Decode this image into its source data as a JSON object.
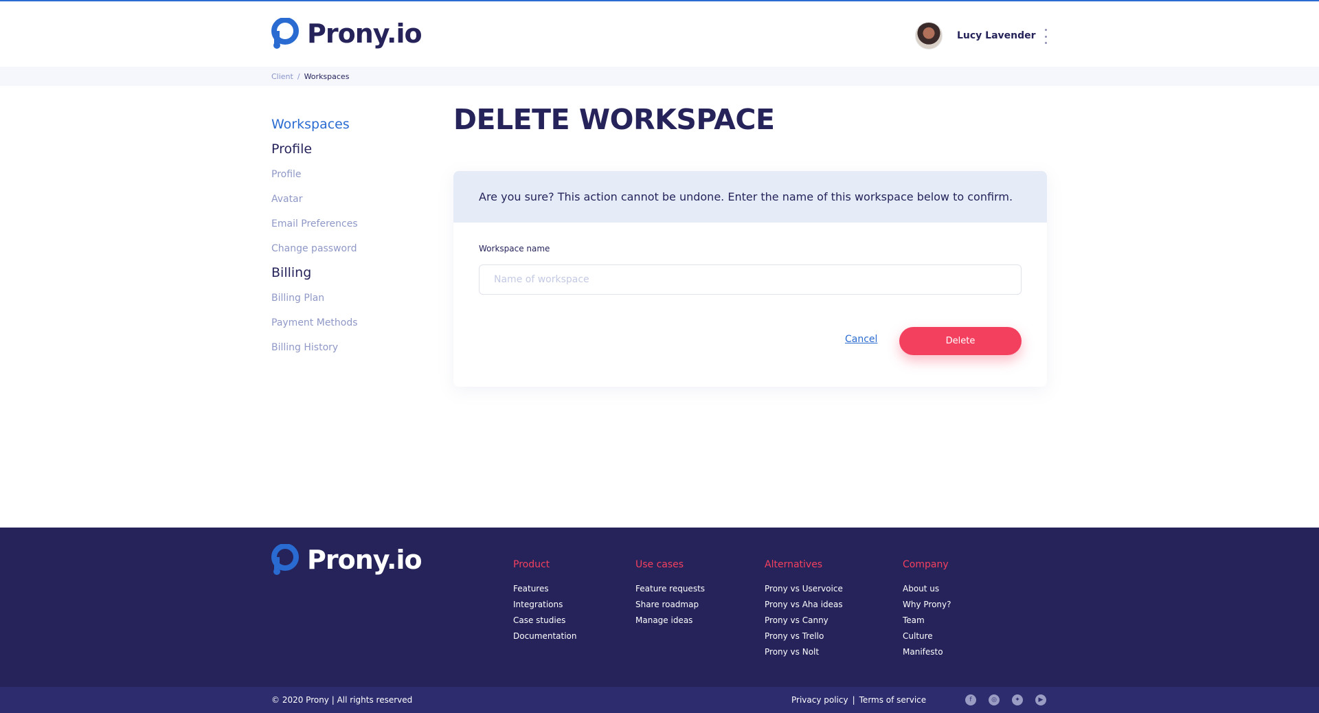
{
  "header": {
    "logo_text": "Prony.io",
    "user_name": "Lucy Lavender"
  },
  "breadcrumb": {
    "items": [
      "Client",
      "Workspaces"
    ],
    "separator": "/"
  },
  "sidebar": {
    "active": "Workspaces",
    "profile_heading": "Profile",
    "profile_items": [
      "Profile",
      "Avatar",
      "Email Preferences",
      "Change password"
    ],
    "billing_heading": "Billing",
    "billing_items": [
      "Billing Plan",
      "Payment Methods",
      "Billing History"
    ]
  },
  "main": {
    "title": "DELETE WORKSPACE",
    "warning": "Are you sure? This action cannot be undone. Enter the name of this workspace below to confirm.",
    "field_label": "Workspace name",
    "field_placeholder": "Name of workspace",
    "field_value": "",
    "cancel_label": "Cancel",
    "delete_label": "Delete"
  },
  "footer": {
    "logo_text": "Prony.io",
    "columns": [
      {
        "heading": "Product",
        "links": [
          "Features",
          "Integrations",
          "Case studies",
          "Documentation"
        ]
      },
      {
        "heading": "Use cases",
        "links": [
          "Feature requests",
          "Share roadmap",
          "Manage ideas"
        ]
      },
      {
        "heading": "Alternatives",
        "links": [
          "Prony vs Uservoice",
          "Prony vs Aha ideas",
          "Prony vs Canny",
          "Prony vs Trello",
          "Prony vs Nolt"
        ]
      },
      {
        "heading": "Company",
        "links": [
          "About us",
          "Why Prony?",
          "Team",
          "Culture",
          "Manifesto"
        ]
      }
    ],
    "copyright": "© 2020 Prony  |  All rights reserved",
    "privacy_label": "Privacy policy",
    "legal_separator": "|",
    "terms_label": "Terms of service",
    "social_icons": [
      "facebook-icon",
      "instagram-icon",
      "twitter-icon",
      "youtube-icon"
    ]
  },
  "colors": {
    "brand_navy": "#25235a",
    "brand_blue": "#2a6bd1",
    "accent_red": "#f4405f"
  }
}
